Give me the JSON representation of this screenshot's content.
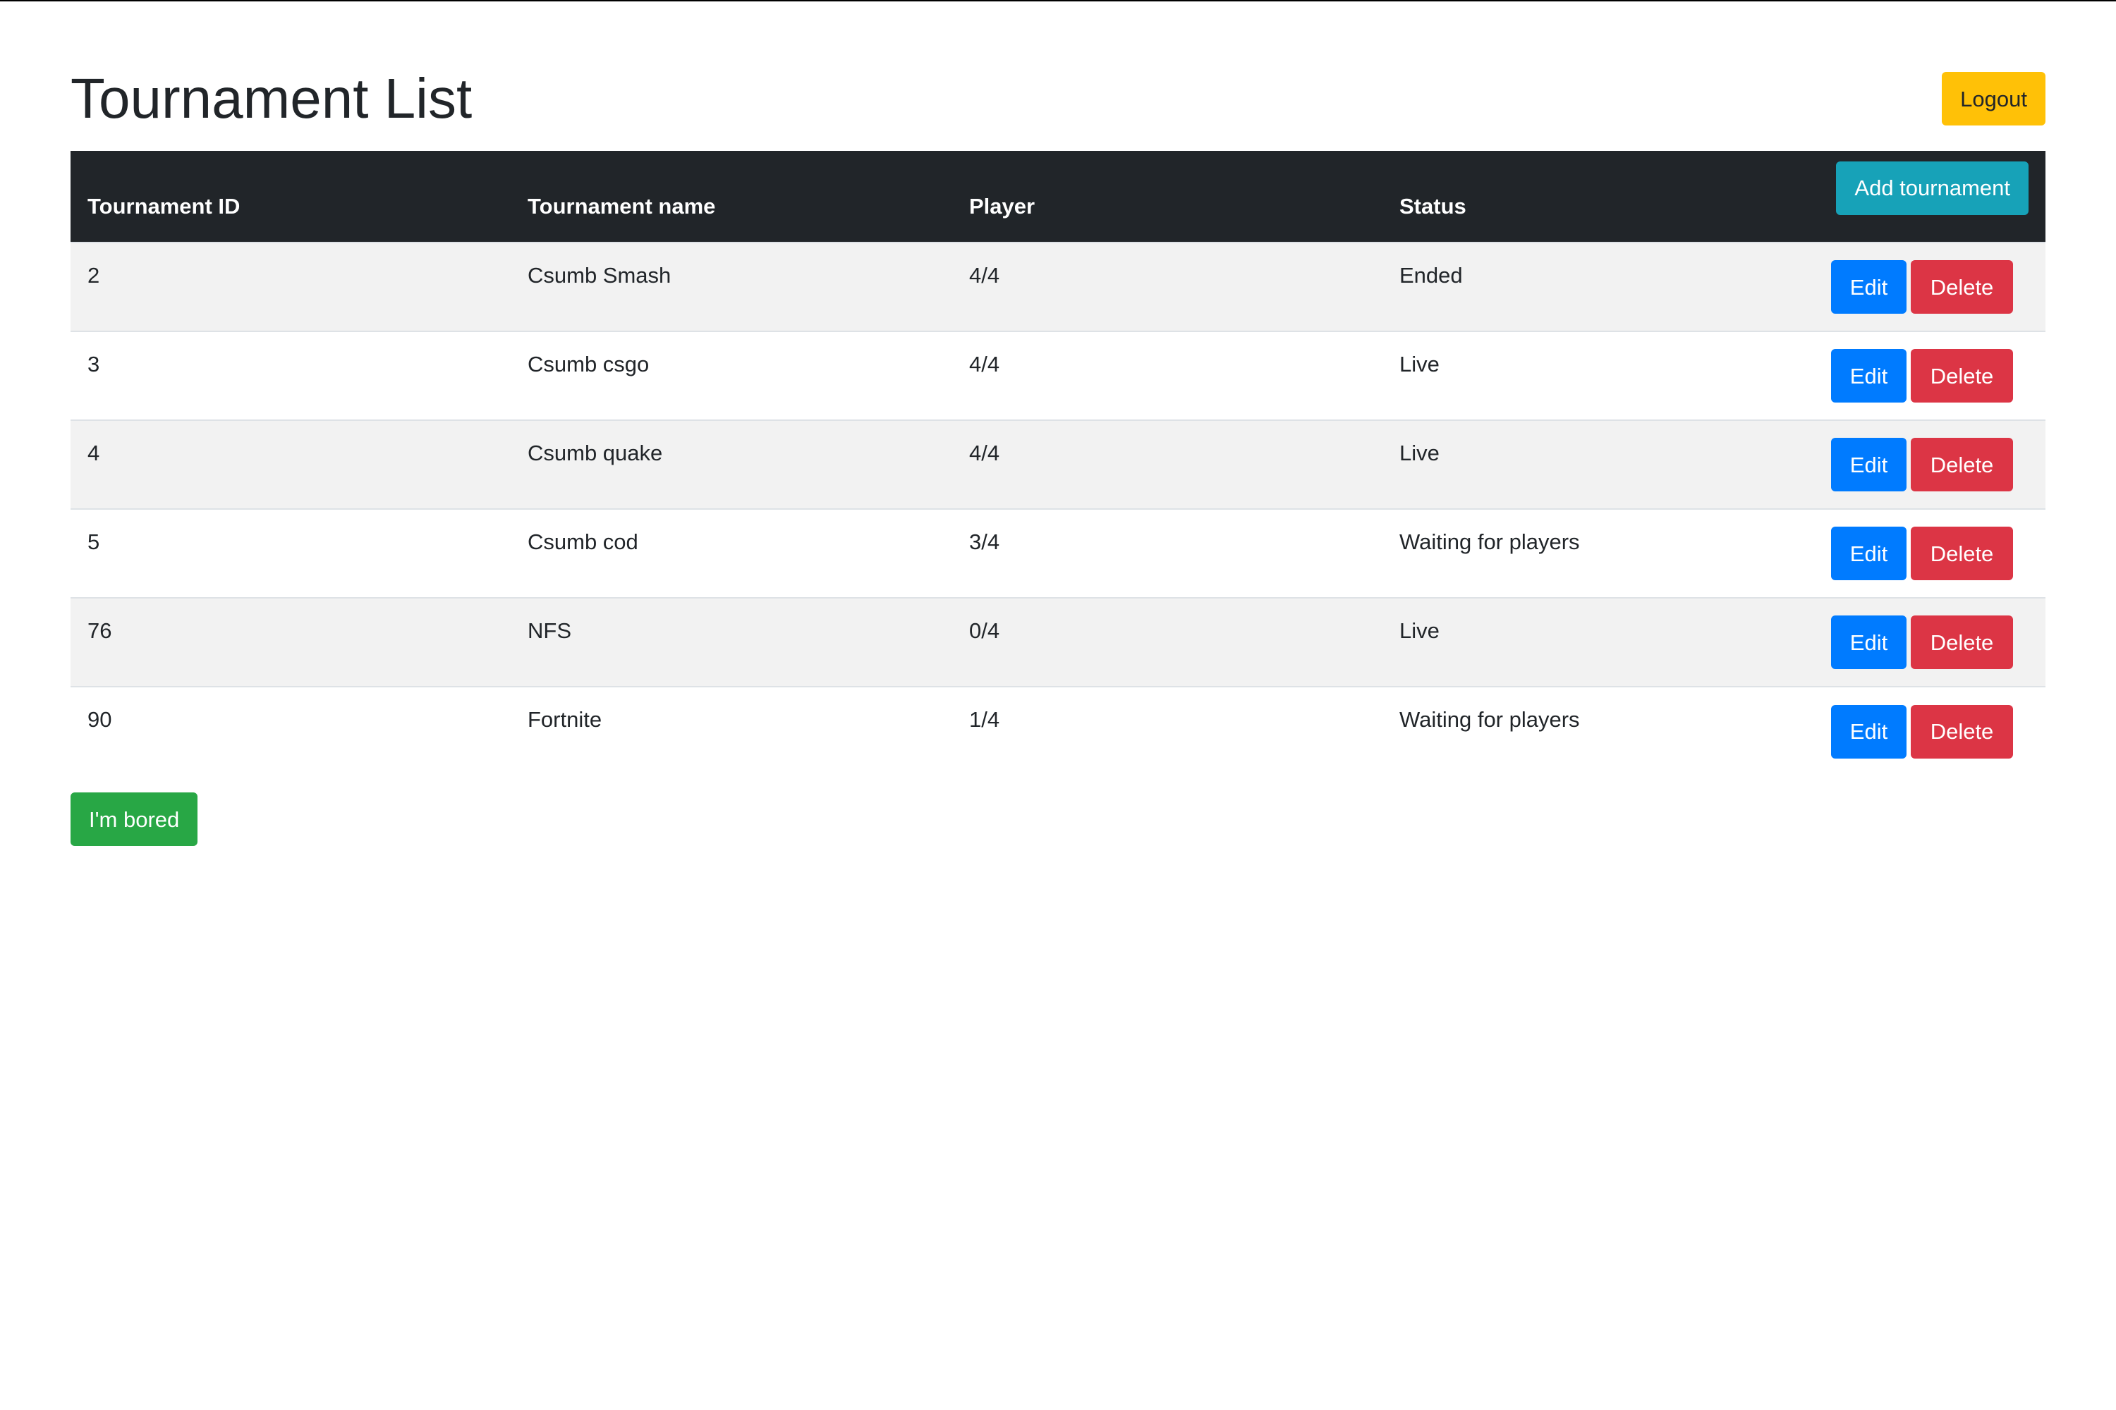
{
  "page": {
    "title": "Tournament List",
    "logout_label": "Logout",
    "bored_label": "I'm bored"
  },
  "table": {
    "headers": {
      "id": "Tournament ID",
      "name": "Tournament name",
      "player": "Player",
      "status": "Status"
    },
    "add_label": "Add tournament",
    "edit_label": "Edit",
    "delete_label": "Delete",
    "rows": [
      {
        "id": "2",
        "name": "Csumb Smash",
        "player": "4/4",
        "status": "Ended"
      },
      {
        "id": "3",
        "name": "Csumb csgo",
        "player": "4/4",
        "status": "Live"
      },
      {
        "id": "4",
        "name": "Csumb quake",
        "player": "4/4",
        "status": "Live"
      },
      {
        "id": "5",
        "name": "Csumb cod",
        "player": "3/4",
        "status": "Waiting for players"
      },
      {
        "id": "76",
        "name": "NFS",
        "player": "0/4",
        "status": "Live"
      },
      {
        "id": "90",
        "name": "Fortnite",
        "player": "1/4",
        "status": "Waiting for players"
      }
    ]
  },
  "colors": {
    "header_bg": "#212529",
    "logout": "#ffc107",
    "add": "#17a2b8",
    "edit": "#007bff",
    "delete": "#dc3545",
    "bored": "#28a745",
    "stripe": "#f2f2f2"
  }
}
